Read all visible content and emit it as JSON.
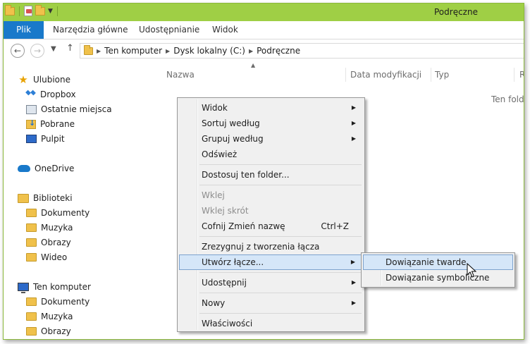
{
  "window": {
    "title": "Podręczne"
  },
  "ribbon": {
    "tabs": [
      {
        "label": "Plik"
      },
      {
        "label": "Narzędzia główne"
      },
      {
        "label": "Udostępnianie"
      },
      {
        "label": "Widok"
      }
    ]
  },
  "address": {
    "crumbs": [
      "Ten komputer",
      "Dysk lokalny (C:)",
      "Podręczne"
    ]
  },
  "nav": {
    "favorites": {
      "label": "Ulubione",
      "items": [
        "Dropbox",
        "Ostatnie miejsca",
        "Pobrane",
        "Pulpit"
      ]
    },
    "onedrive": {
      "label": "OneDrive"
    },
    "libraries": {
      "label": "Biblioteki",
      "items": [
        "Dokumenty",
        "Muzyka",
        "Obrazy",
        "Wideo"
      ]
    },
    "computer": {
      "label": "Ten komputer",
      "items": [
        "Dokumenty",
        "Muzyka",
        "Obrazy"
      ]
    }
  },
  "columns": [
    "Nazwa",
    "Data modyfikacji",
    "Typ",
    "R"
  ],
  "content": {
    "empty_message": "Ten folde"
  },
  "context_menu": {
    "items": [
      {
        "label": "Widok",
        "submenu": true
      },
      {
        "label": "Sortuj według",
        "submenu": true
      },
      {
        "label": "Grupuj według",
        "submenu": true
      },
      {
        "label": "Odśwież"
      },
      {
        "label": "Dostosuj ten folder..."
      },
      {
        "label": "Wklej",
        "disabled": true
      },
      {
        "label": "Wklej skrót",
        "disabled": true
      },
      {
        "label": "Cofnij Zmień nazwę",
        "shortcut": "Ctrl+Z"
      },
      {
        "label": "Zrezygnuj z tworzenia łącza"
      },
      {
        "label": "Utwórz łącze...",
        "submenu": true,
        "highlighted": true
      },
      {
        "label": "Udostępnij",
        "submenu": true
      },
      {
        "label": "Nowy",
        "submenu": true
      },
      {
        "label": "Właściwości"
      }
    ],
    "submenu": [
      {
        "label": "Dowiązanie twarde",
        "highlighted": true
      },
      {
        "label": "Dowiązanie symboliczne"
      }
    ]
  }
}
